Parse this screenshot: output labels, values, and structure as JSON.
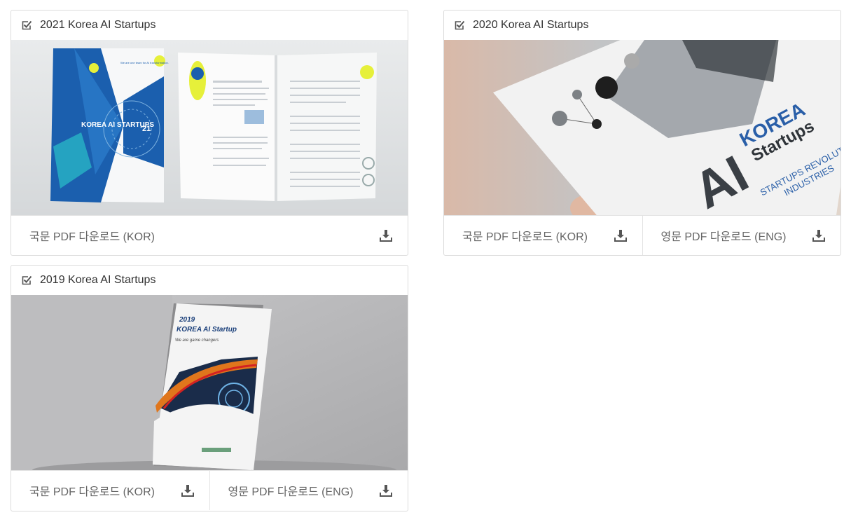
{
  "cards": [
    {
      "title": "2021 Korea AI Startups",
      "buttons": [
        {
          "label": "국문 PDF 다운로드 (KOR)"
        }
      ]
    },
    {
      "title": "2020 Korea AI Startups",
      "buttons": [
        {
          "label": "국문 PDF 다운로드 (KOR)"
        },
        {
          "label": "영문 PDF 다운로드 (ENG)"
        }
      ]
    },
    {
      "title": "2019 Korea AI Startups",
      "buttons": [
        {
          "label": "국문 PDF 다운로드 (KOR)"
        },
        {
          "label": "영문 PDF 다운로드 (ENG)"
        }
      ]
    }
  ],
  "covers": {
    "c2021": {
      "cover_title": "KOREA AI STARTUPS",
      "year": "‘21",
      "tagline": "We are one team for AI transformation."
    },
    "c2020": {
      "word1": "AI",
      "word2": "KOREA",
      "word3": "Startups",
      "subtitle": "STARTUPS REVOLUTIONIZE",
      "subtitle2": "INDUSTRIES"
    },
    "c2019": {
      "year": "2019",
      "title": "KOREA AI Startup",
      "tagline": "We are game changers"
    }
  },
  "colors": {
    "border": "#dcdcdc",
    "text": "#333333",
    "muted": "#666666",
    "icon": "#555555"
  },
  "icons": {
    "header": "checkbox-checked-icon",
    "download": "download-icon"
  }
}
